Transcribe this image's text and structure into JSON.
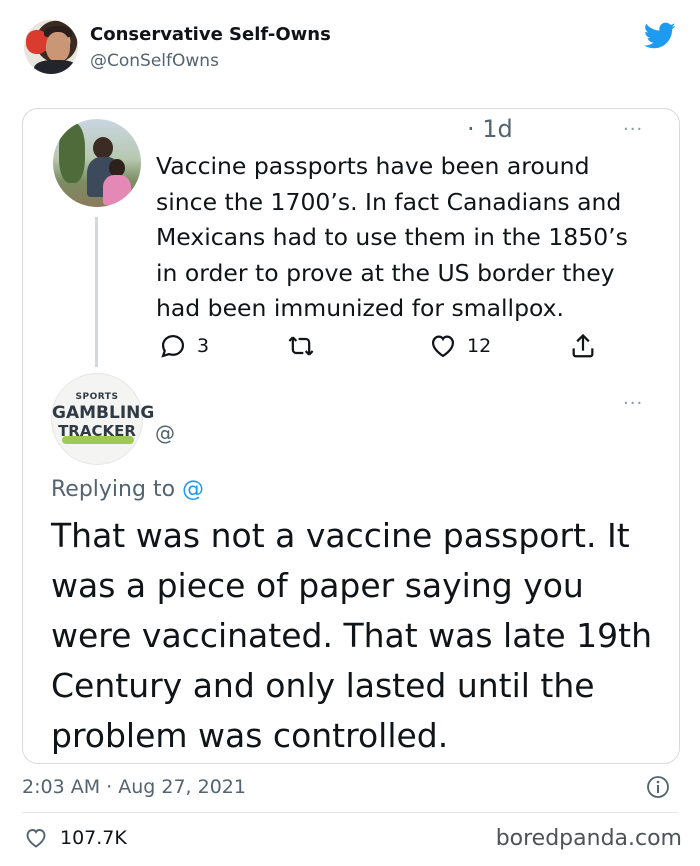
{
  "tweet": {
    "display_name": "Conservative Self-Owns",
    "handle": "@ConSelfOwns",
    "timestamp": "2:03 AM · Aug 27, 2021",
    "likes": "107.7K"
  },
  "quoted": {
    "time": "· 1d",
    "text": "Vaccine passports have been around since the 1700’s. In fact Canadians and Mexicans had to use them in the 1850’s in order to prove at the US border they had been immunized for smallpox.",
    "reply_count": "3",
    "like_count": "12",
    "more": "···"
  },
  "reply": {
    "avatar_text": [
      "SPORTS",
      "GAMBLING",
      "TRACKER"
    ],
    "handle": "@",
    "replying_label": "Replying to ",
    "replying_to": "@",
    "text": "That was not a vaccine passport.  It was a piece of paper saying you were vaccinated.  That was late 19th Century and only lasted until the problem was controlled.",
    "more": "···"
  },
  "watermark": "boredpanda.com",
  "colors": {
    "accent": "#1d9bf0",
    "muted": "#536471"
  }
}
